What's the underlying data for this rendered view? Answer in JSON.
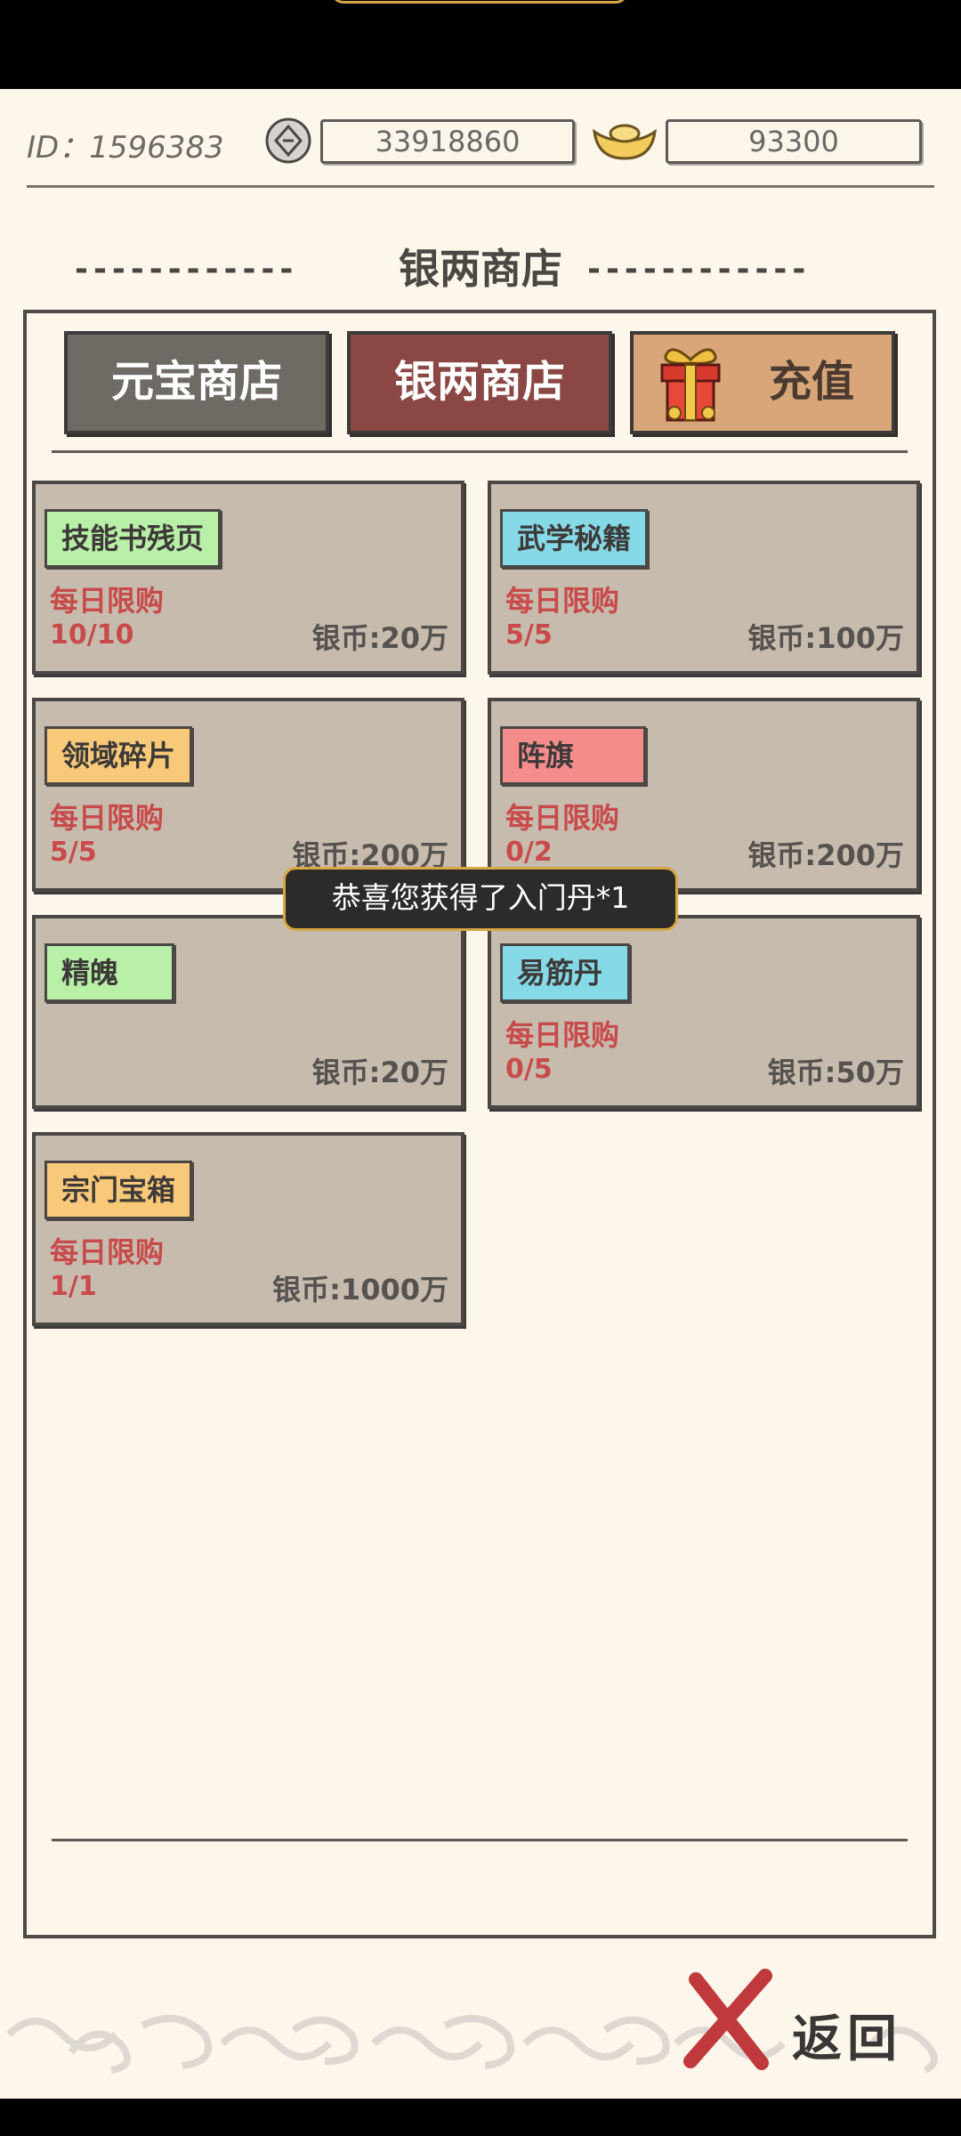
{
  "header": {
    "id_text": "ID：1596383",
    "silver_value": "33918860",
    "ingot_value": "93300"
  },
  "title": {
    "dashes": "------------",
    "text": "银两商店"
  },
  "tabs": [
    {
      "label": "元宝商店"
    },
    {
      "label": "银两商店"
    },
    {
      "label": "充值"
    }
  ],
  "items": [
    {
      "name": "技能书残页",
      "limit": "每日限购",
      "count": "10/10",
      "price": "银币:20万",
      "color": "#b8f0a8"
    },
    {
      "name": "武学秘籍",
      "limit": "每日限购",
      "count": "5/5",
      "price": "银币:100万",
      "color": "#86d9e6"
    },
    {
      "name": "领域碎片",
      "limit": "每日限购",
      "count": "5/5",
      "price": "银币:200万",
      "color": "#f7c978"
    },
    {
      "name": "阵旗",
      "limit": "每日限购",
      "count": "0/2",
      "price": "银币:200万",
      "color": "#f58c8c"
    },
    {
      "name": "精魄",
      "limit": "",
      "count": "",
      "price": "银币:20万",
      "color": "#b8f0a8"
    },
    {
      "name": "易筋丹",
      "limit": "每日限购",
      "count": "0/5",
      "price": "银币:50万",
      "color": "#86d9e6"
    },
    {
      "name": "宗门宝箱",
      "limit": "每日限购",
      "count": "1/1",
      "price": "银币:1000万",
      "color": "#f7c978"
    }
  ],
  "toast": "恭喜您获得了入门丹*1",
  "back_label": "返回"
}
